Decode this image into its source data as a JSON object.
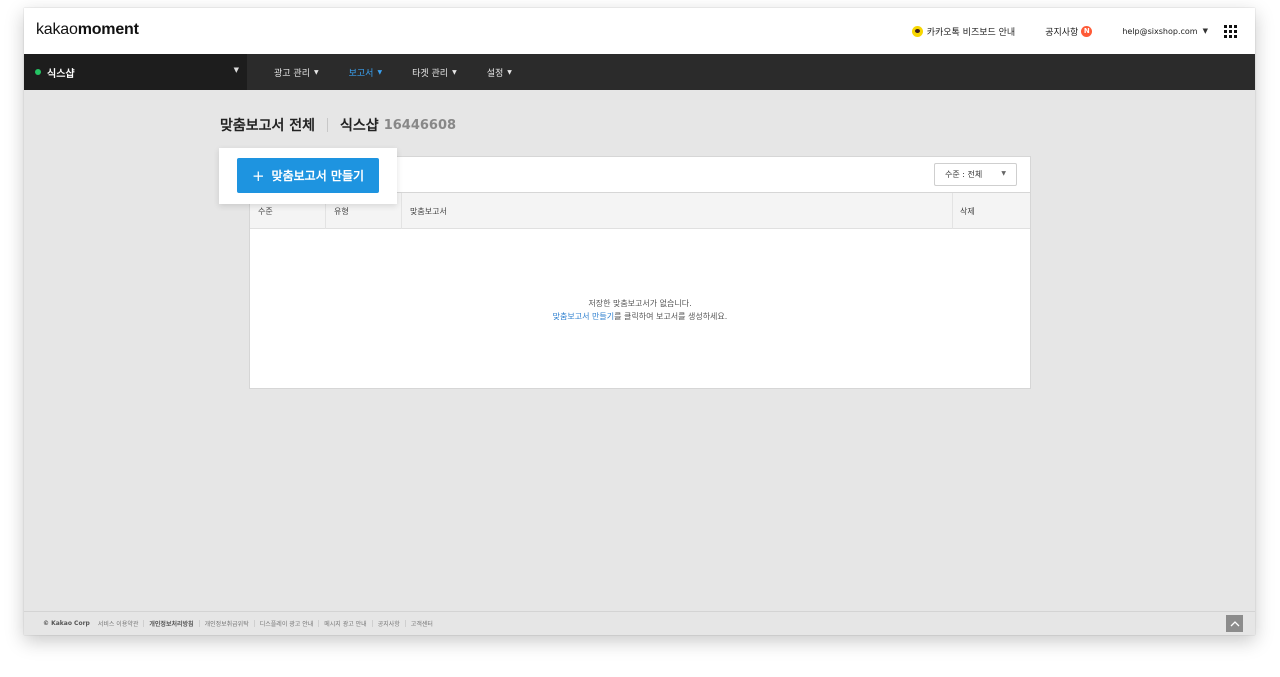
{
  "header": {
    "logo_prefix": "kakao",
    "logo_bold": "moment",
    "bizboard_label": "카카오톡 비즈보드 안내",
    "notice_label": "공지사항",
    "notice_badge": "N",
    "account_email": "help@sixshop.com",
    "kakao_icon_color": "#f7d600",
    "badge_color": "#ff5a36"
  },
  "nav": {
    "account_name": "식스샵",
    "account_status_color": "#25c464",
    "menu": [
      {
        "label": "광고 관리",
        "active": false
      },
      {
        "label": "보고서",
        "active": true
      },
      {
        "label": "타겟 관리",
        "active": false
      },
      {
        "label": "설정",
        "active": false
      }
    ],
    "active_color": "#3aa0ef"
  },
  "page": {
    "title": "맞춤보고서 전체",
    "account_name": "식스샵",
    "account_id": "16446608"
  },
  "create_button": {
    "icon": "+",
    "label": "맞춤보고서 만들기",
    "color": "#1e94e0"
  },
  "filter": {
    "level_select": "수준 : 전체"
  },
  "table": {
    "columns": [
      "수준",
      "유형",
      "맞춤보고서",
      "삭제"
    ],
    "empty_line1": "저장한 맞춤보고서가 없습니다.",
    "empty_link": "맞춤보고서 만들기",
    "empty_line2_rest": "를 클릭하여 보고서를 생성하세요."
  },
  "footer": {
    "copyright": "© Kakao Corp",
    "links": [
      {
        "label": "서비스 이용약관",
        "bold": false
      },
      {
        "label": "개인정보처리방침",
        "bold": true
      },
      {
        "label": "개인정보취급위탁",
        "bold": false
      },
      {
        "label": "디스플레이 광고 안내",
        "bold": false
      },
      {
        "label": "메시지 광고 안내",
        "bold": false
      },
      {
        "label": "공지사항",
        "bold": false
      },
      {
        "label": "고객센터",
        "bold": false
      }
    ]
  }
}
